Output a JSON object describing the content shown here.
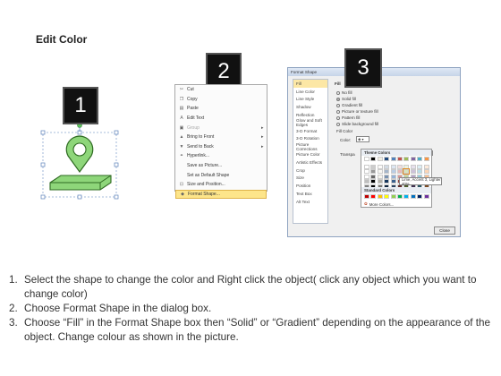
{
  "title": "Edit Color",
  "badges": [
    "1",
    "2",
    "3"
  ],
  "context_menu": {
    "items": [
      {
        "label": "Cut",
        "icon": "scissors-icon",
        "glyph": "✂",
        "arrow": false,
        "disabled": false,
        "highlight": false
      },
      {
        "label": "Copy",
        "icon": "copy-icon",
        "glyph": "❐",
        "arrow": false,
        "disabled": false,
        "highlight": false
      },
      {
        "label": "Paste",
        "icon": "paste-icon",
        "glyph": "▤",
        "arrow": false,
        "disabled": false,
        "highlight": false
      },
      {
        "label": "Edit Text",
        "icon": "edit-text-icon",
        "glyph": "A",
        "arrow": false,
        "disabled": false,
        "highlight": false
      },
      {
        "label": "Group",
        "icon": "group-icon",
        "glyph": "▣",
        "arrow": true,
        "disabled": true,
        "highlight": false
      },
      {
        "label": "Bring to Front",
        "icon": "bring-front-icon",
        "glyph": "▲",
        "arrow": true,
        "disabled": false,
        "highlight": false
      },
      {
        "label": "Send to Back",
        "icon": "send-back-icon",
        "glyph": "▼",
        "arrow": true,
        "disabled": false,
        "highlight": false
      },
      {
        "label": "Hyperlink...",
        "icon": "hyperlink-icon",
        "glyph": "⚭",
        "arrow": false,
        "disabled": false,
        "highlight": false
      },
      {
        "label": "Save as Picture...",
        "icon": "",
        "glyph": "",
        "arrow": false,
        "disabled": false,
        "highlight": false
      },
      {
        "label": "Set as Default Shape",
        "icon": "",
        "glyph": "",
        "arrow": false,
        "disabled": false,
        "highlight": false
      },
      {
        "label": "Size and Position...",
        "icon": "size-position-icon",
        "glyph": "⊡",
        "arrow": false,
        "disabled": false,
        "highlight": false
      },
      {
        "label": "Format Shape...",
        "icon": "format-shape-icon",
        "glyph": "◆",
        "arrow": false,
        "disabled": false,
        "highlight": true
      }
    ]
  },
  "dialog": {
    "title": "Format Shape",
    "categories": [
      "Fill",
      "Line Color",
      "Line Style",
      "Shadow",
      "Reflection",
      "Glow and Soft Edges",
      "3-D Format",
      "3-D Rotation",
      "Picture Corrections",
      "Picture Color",
      "Artistic Effects",
      "Crop",
      "Size",
      "Position",
      "Text Box",
      "Alt Text"
    ],
    "selected_category": "Fill",
    "pane_title": "Fill",
    "options": [
      "No fill",
      "Solid fill",
      "Gradient fill",
      "Picture or texture fill",
      "Pattern fill",
      "Slide background fill"
    ],
    "selected_option": "Solid fill",
    "fill_color_label": "Fill Color",
    "color_label": "Color:",
    "transparency_label": "Transpa",
    "close_label": "Close"
  },
  "color_popup": {
    "theme_label": "Theme Colors",
    "standard_label": "Standard Colors",
    "more_label": "More Colors...",
    "tooltip": "Lime, Accent 3, Lighter 40%",
    "theme_columns": [
      "#ffffff",
      "#000000",
      "#eeece1",
      "#1f497d",
      "#4f81bd",
      "#c0504d",
      "#9bbb59",
      "#8064a2",
      "#4bacc6",
      "#f79646"
    ],
    "standard_colors": [
      "#c00000",
      "#ff0000",
      "#ffc000",
      "#ffff00",
      "#92d050",
      "#00b050",
      "#00b0f0",
      "#0070c0",
      "#002060",
      "#7030a0"
    ]
  },
  "steps": [
    "Select the shape to change the color and Right click the object( click any object which you want to change color)",
    "Choose Format Shape in the dialog box.",
    "Choose “Fill” in the Format Shape box then “Solid” or “Gradient” depending on the appearance of the object. Change colour as shown in the picture."
  ]
}
